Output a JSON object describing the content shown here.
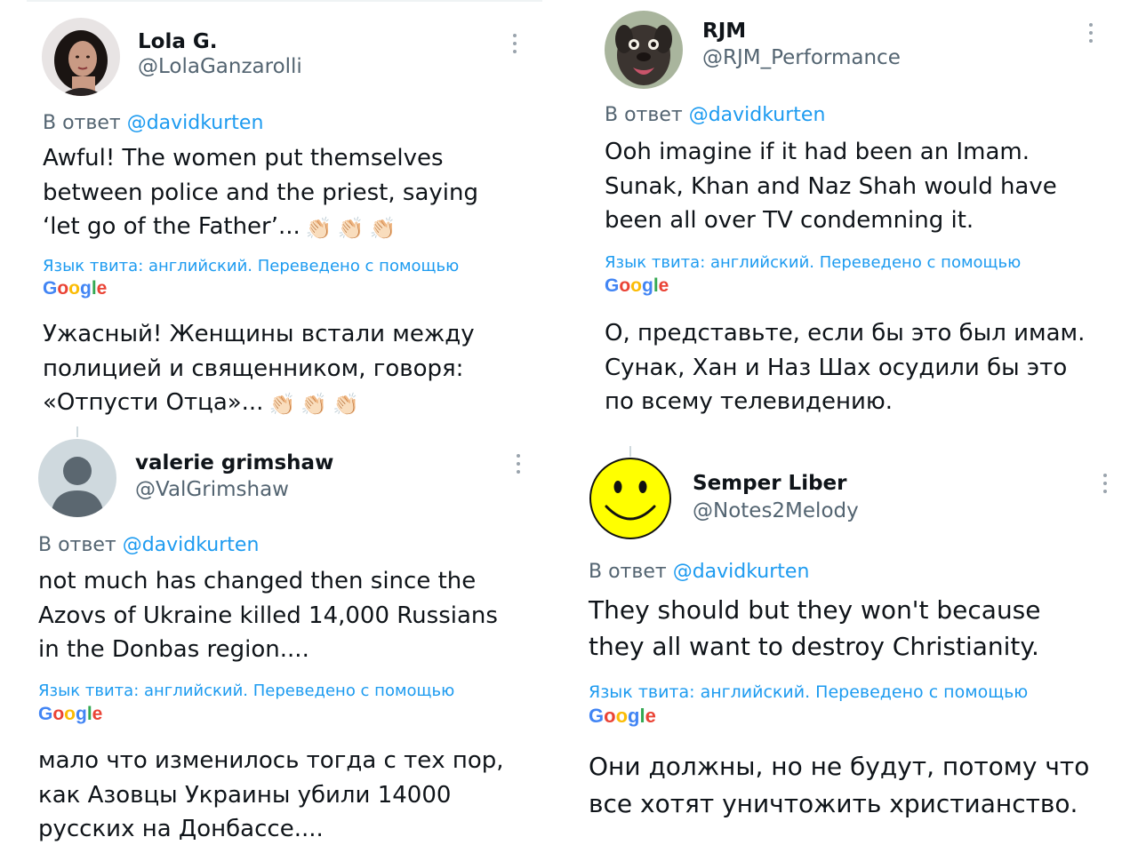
{
  "reply_prefix": "В ответ",
  "reply_to": "@davidkurten",
  "translation_note": "Язык твита: английский. Переведено с помощью",
  "google_label": "Google",
  "clap_icon": "👏🏻",
  "tweets": [
    {
      "name": "Lola G.",
      "handle": "@LolaGanzarolli",
      "text_lines": [
        "Awful! The women put themselves",
        "between police and the priest, saying",
        "‘let go of the Father’..."
      ],
      "translated_lines": [
        "Ужасный! Женщины встали между",
        "полицией и священником, говоря:",
        "«Отпусти Отца»..."
      ]
    },
    {
      "name": "RJM",
      "handle": "@RJM_Performance",
      "text_lines": [
        "Ooh imagine if it had been an Imam.",
        "Sunak, Khan and Naz Shah would have",
        "been all over TV condemning it."
      ],
      "translated_lines": [
        "О, представьте, если бы это был имам.",
        "Сунак, Хан и Наз Шах осудили бы это",
        "по всему телевидению."
      ]
    },
    {
      "name": "valerie grimshaw",
      "handle": "@ValGrimshaw",
      "text_lines": [
        "not much has changed then since the",
        "Azovs of Ukraine killed 14,000 Russians",
        "in the Donbas region...."
      ],
      "translated_lines": [
        "мало что изменилось тогда с тех пор,",
        "как Азовцы Украины убили 14000",
        "русских на Донбассе...."
      ]
    },
    {
      "name": "Semper Liber",
      "handle": "@Notes2Melody",
      "text_lines": [
        "They should but they won't because",
        "they all want to destroy Christianity."
      ],
      "translated_lines": [
        "Они должны, но не будут, потому что",
        "все хотят уничтожить христианство."
      ]
    }
  ],
  "colors": {
    "link_blue": "#1d9bf0",
    "secondary_text": "#536471",
    "primary_text": "#0f1419",
    "google_blue": "#4285F4",
    "google_red": "#EA4335",
    "google_yellow": "#FBBC05",
    "google_green": "#34A853"
  }
}
